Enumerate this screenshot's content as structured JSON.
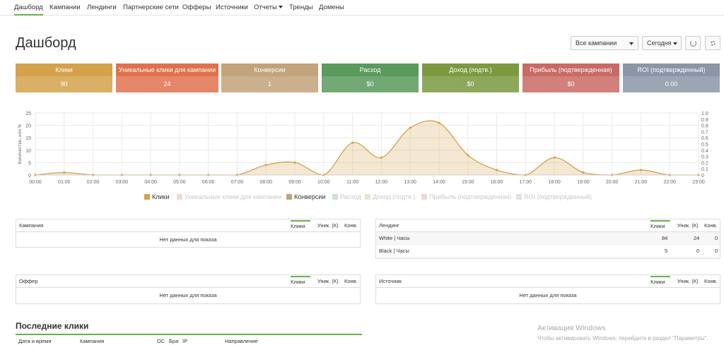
{
  "nav": {
    "items": [
      "Дашборд",
      "Кампании",
      "Лендинги",
      "Партнерские сети",
      "Офферы",
      "Источники",
      "Отчеты",
      "Тренды",
      "Домены"
    ]
  },
  "page_title": "Дашборд",
  "controls": {
    "campaign_select": "Все кампании",
    "period_select": "Сегодня"
  },
  "cards": [
    {
      "label": "Клики",
      "value": "90",
      "color": "#d4a24c"
    },
    {
      "label": "Уникальные клики для кампании",
      "value": "24",
      "color": "#e0714d"
    },
    {
      "label": "Конверсии",
      "value": "1",
      "color": "#c2a37b"
    },
    {
      "label": "Расход",
      "value": "$0",
      "color": "#5a9a5c"
    },
    {
      "label": "Доход (подтв.)",
      "value": "$0",
      "color": "#7b9a3f"
    },
    {
      "label": "Прибыль (подтвержденная)",
      "value": "$0",
      "color": "#c96a64"
    },
    {
      "label": "ROI (подтвержденный)",
      "value": "0.00",
      "color": "#8a96a8"
    }
  ],
  "chart_data": {
    "type": "area",
    "x": [
      "00:00",
      "01:00",
      "02:00",
      "03:00",
      "04:00",
      "05:00",
      "06:00",
      "07:00",
      "08:00",
      "09:00",
      "10:00",
      "11:00",
      "12:00",
      "13:00",
      "14:00",
      "15:00",
      "16:00",
      "17:00",
      "18:00",
      "19:00",
      "20:00",
      "21:00",
      "22:00",
      "23:00"
    ],
    "series": [
      {
        "name": "Клики",
        "values": [
          0,
          1,
          0,
          0,
          0,
          0,
          0,
          0,
          4,
          5,
          0,
          13,
          7,
          19,
          21,
          8,
          2,
          0,
          7,
          1,
          0,
          2,
          0,
          0
        ],
        "color": "#d4a24c"
      },
      {
        "name": "Уникальные клики для кампании",
        "values": [],
        "color": "#f6d8cf"
      },
      {
        "name": "Конверсии",
        "values": [],
        "color": "#c2a37b"
      },
      {
        "name": "Расход",
        "values": [],
        "color": "#cde3cd"
      },
      {
        "name": "Доход (подтв.)",
        "values": [],
        "color": "#e2e8cf"
      },
      {
        "name": "Прибыль (подтвержденная)",
        "values": [],
        "color": "#f2d6d4"
      },
      {
        "name": "ROI (подтвержденный)",
        "values": [],
        "color": "#dfe2e8"
      }
    ],
    "ylabel": "Количество, или %",
    "ylabel2": "USD",
    "ylim": [
      0,
      25
    ],
    "yticks": [
      "0",
      "5",
      "10",
      "15",
      "20",
      "25"
    ],
    "ylim2": [
      0,
      1
    ],
    "yticks2": [
      "0",
      "0.1",
      "0.2",
      "0.3",
      "0.4",
      "0.5",
      "0.6",
      "0.7",
      "0.8",
      "0.9",
      "1.0"
    ],
    "grid": true,
    "legend": "bottom"
  },
  "panels": {
    "campaign": {
      "title": "Кампания",
      "cols": [
        "Клики",
        "Уник. (К)",
        "Конв."
      ],
      "empty": "Нет данных для показа"
    },
    "landing": {
      "title": "Лендинг",
      "cols": [
        "Клики",
        "Уник. (К)",
        "Конв."
      ],
      "rows": [
        {
          "name": "White | Часы",
          "clicks": "84",
          "uniq": "24",
          "conv": "0"
        },
        {
          "name": "Black | Часы",
          "clicks": "5",
          "uniq": "0",
          "conv": "0"
        }
      ]
    },
    "offer": {
      "title": "Оффер",
      "cols": [
        "Клики",
        "Уник. (К)",
        "Конв."
      ],
      "empty": "Нет данных для показа"
    },
    "source": {
      "title": "Источник",
      "cols": [
        "Клики",
        "Уник. (К)",
        "Конв."
      ],
      "empty": "Нет данных для показа"
    }
  },
  "recent": {
    "title": "Последние клики",
    "cols": [
      "Дата и время",
      "Кампания",
      "ОС",
      "Бра",
      "IP",
      "Направление"
    ]
  },
  "watermark": {
    "title": "Активация Windows",
    "text": "Чтобы активировать Windows, перейдите в раздел \"Параметры\"."
  }
}
